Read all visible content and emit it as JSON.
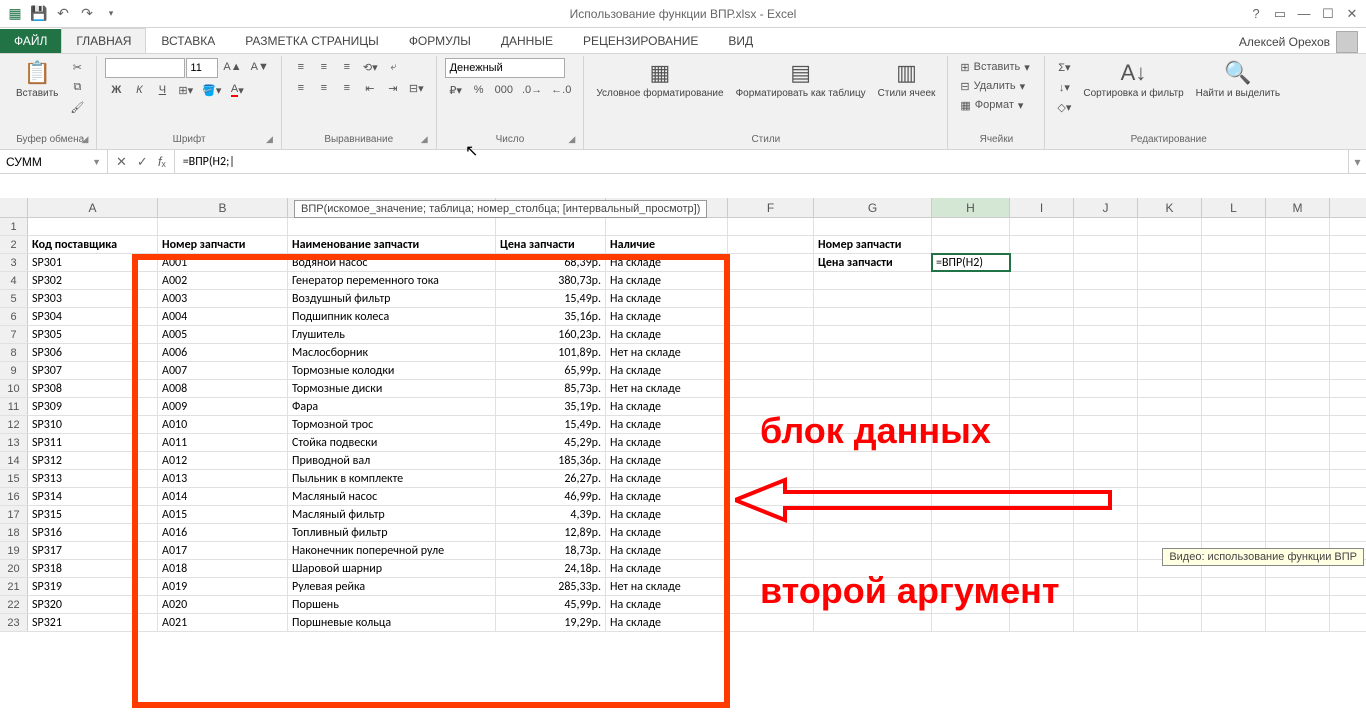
{
  "app": {
    "title": "Использование функции ВПР.xlsx - Excel",
    "user": "Алексей Орехов"
  },
  "tabs": {
    "file": "ФАЙЛ",
    "home": "ГЛАВНАЯ",
    "insert": "ВСТАВКА",
    "pagelayout": "РАЗМЕТКА СТРАНИЦЫ",
    "formulas": "ФОРМУЛЫ",
    "data": "ДАННЫЕ",
    "review": "РЕЦЕНЗИРОВАНИЕ",
    "view": "ВИД"
  },
  "ribbon": {
    "clipboard": {
      "paste": "Вставить",
      "label": "Буфер обмена"
    },
    "font": {
      "size": "11",
      "label": "Шрифт"
    },
    "align": {
      "label": "Выравнивание"
    },
    "number": {
      "format": "Денежный",
      "label": "Число"
    },
    "styles": {
      "cond": "Условное форматирование",
      "table": "Форматировать как таблицу",
      "cell": "Стили ячеек",
      "label": "Стили"
    },
    "cells": {
      "insert": "Вставить",
      "delete": "Удалить",
      "format": "Формат",
      "label": "Ячейки"
    },
    "editing": {
      "sort": "Сортировка и фильтр",
      "find": "Найти и выделить",
      "label": "Редактирование"
    }
  },
  "formulaBar": {
    "name": "СУММ",
    "formula": "=ВПР(H2;|",
    "tooltip": "ВПР(искомое_значение; таблица; номер_столбца; [интервальный_просмотр])"
  },
  "columns": [
    "A",
    "B",
    "C",
    "D",
    "E",
    "F",
    "G",
    "H",
    "I",
    "J",
    "K",
    "L",
    "M"
  ],
  "headers": {
    "A": "Код поставщика",
    "B": "Номер запчасти",
    "C": "Наименование запчасти",
    "D": "Цена запчасти",
    "E": "Наличие"
  },
  "side": {
    "g2": "Номер запчасти",
    "g3": "Цена запчасти",
    "h3": "=ВПР(H2)"
  },
  "rows": [
    {
      "a": "SP301",
      "b": "A001",
      "c": "Водяной насос",
      "d": "68,39p.",
      "e": "На складе"
    },
    {
      "a": "SP302",
      "b": "A002",
      "c": "Генератор переменного тока",
      "d": "380,73p.",
      "e": "На складе"
    },
    {
      "a": "SP303",
      "b": "A003",
      "c": "Воздушный фильтр",
      "d": "15,49p.",
      "e": "На складе"
    },
    {
      "a": "SP304",
      "b": "A004",
      "c": "Подшипник колеса",
      "d": "35,16p.",
      "e": "На складе"
    },
    {
      "a": "SP305",
      "b": "A005",
      "c": "Глушитель",
      "d": "160,23p.",
      "e": "На складе"
    },
    {
      "a": "SP306",
      "b": "A006",
      "c": "Маслосборник",
      "d": "101,89p.",
      "e": "Нет на складе"
    },
    {
      "a": "SP307",
      "b": "A007",
      "c": "Тормозные колодки",
      "d": "65,99p.",
      "e": "На складе"
    },
    {
      "a": "SP308",
      "b": "A008",
      "c": "Тормозные диски",
      "d": "85,73p.",
      "e": "Нет на складе"
    },
    {
      "a": "SP309",
      "b": "A009",
      "c": "Фара",
      "d": "35,19p.",
      "e": "На складе"
    },
    {
      "a": "SP310",
      "b": "A010",
      "c": "Тормозной трос",
      "d": "15,49p.",
      "e": "На складе"
    },
    {
      "a": "SP311",
      "b": "A011",
      "c": "Стойка подвески",
      "d": "45,29p.",
      "e": "На складе"
    },
    {
      "a": "SP312",
      "b": "A012",
      "c": "Приводной вал",
      "d": "185,36p.",
      "e": "На складе"
    },
    {
      "a": "SP313",
      "b": "A013",
      "c": "Пыльник в комплекте",
      "d": "26,27p.",
      "e": "На складе"
    },
    {
      "a": "SP314",
      "b": "A014",
      "c": "Масляный насос",
      "d": "46,99p.",
      "e": "На складе"
    },
    {
      "a": "SP315",
      "b": "A015",
      "c": "Масляный фильтр",
      "d": "4,39p.",
      "e": "На складе"
    },
    {
      "a": "SP316",
      "b": "A016",
      "c": "Топливный фильтр",
      "d": "12,89p.",
      "e": "На складе"
    },
    {
      "a": "SP317",
      "b": "A017",
      "c": "Наконечник поперечной руле",
      "d": "18,73p.",
      "e": "На складе"
    },
    {
      "a": "SP318",
      "b": "A018",
      "c": "Шаровой шарнир",
      "d": "24,18p.",
      "e": "На складе"
    },
    {
      "a": "SP319",
      "b": "A019",
      "c": "Рулевая рейка",
      "d": "285,33p.",
      "e": "Нет на складе"
    },
    {
      "a": "SP320",
      "b": "A020",
      "c": "Поршень",
      "d": "45,99p.",
      "e": "На складе"
    },
    {
      "a": "SP321",
      "b": "A021",
      "c": "Поршневые кольца",
      "d": "19,29p.",
      "e": "На складе"
    }
  ],
  "annotations": {
    "block": "блок данных",
    "second": "второй аргумент"
  },
  "videoTip": "Видео: использование функции ВПР"
}
